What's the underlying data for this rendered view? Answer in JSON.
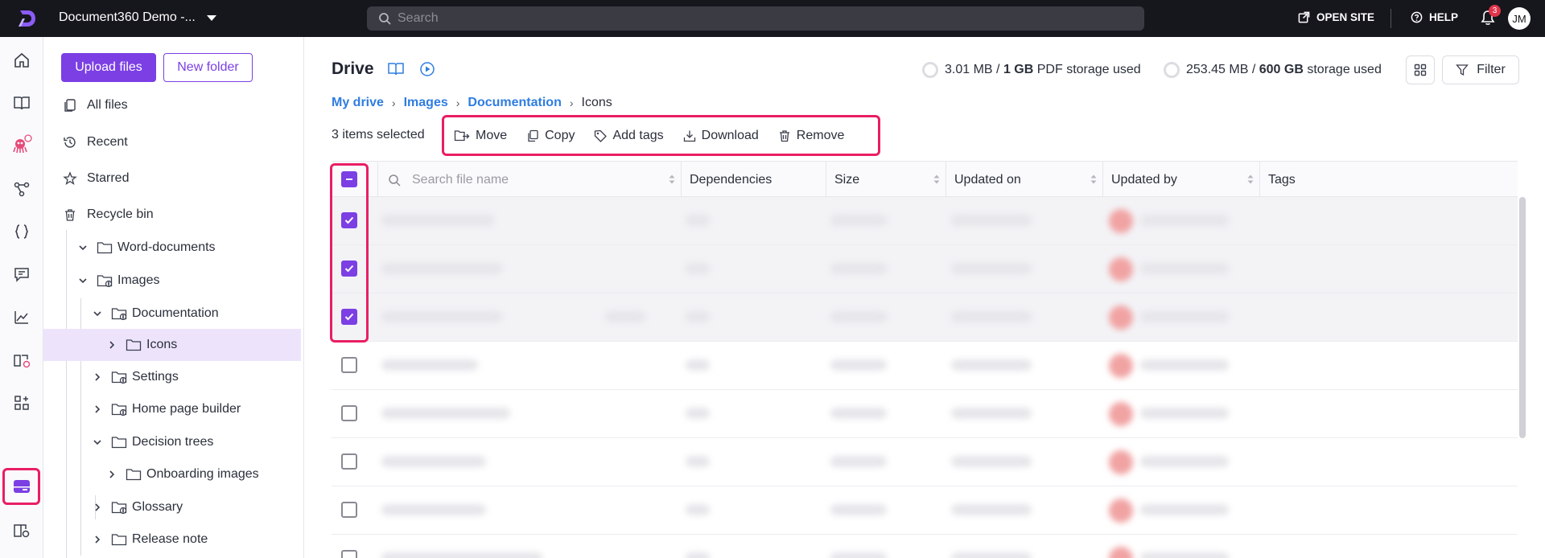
{
  "topbar": {
    "project_name": "Document360 Demo -...",
    "search_placeholder": "Search",
    "open_site_label": "OPEN SITE",
    "help_label": "HELP",
    "notification_count": "3",
    "avatar_initials": "JM"
  },
  "rail": {
    "icons": [
      "home-icon",
      "book-icon",
      "robot-icon",
      "workflow-icon",
      "code-braces-icon",
      "comment-icon",
      "analytics-icon",
      "book-star-icon",
      "apps-icon",
      "drive-icon",
      "book-settings-icon",
      "settings-icon"
    ],
    "active": "drive-icon"
  },
  "sidebar": {
    "upload_label": "Upload files",
    "new_folder_label": "New folder",
    "nav": [
      {
        "label": "All files",
        "icon": "files-icon"
      },
      {
        "label": "Recent",
        "icon": "history-icon"
      },
      {
        "label": "Starred",
        "icon": "star-icon"
      },
      {
        "label": "Recycle bin",
        "icon": "trash-icon"
      }
    ],
    "tree": [
      {
        "label": "Word-documents",
        "level": 0,
        "expanded": true,
        "shared": false
      },
      {
        "label": "Images",
        "level": 0,
        "expanded": true,
        "shared": true
      },
      {
        "label": "Documentation",
        "level": 1,
        "expanded": true,
        "shared": true
      },
      {
        "label": "Icons",
        "level": 2,
        "expanded": false,
        "shared": false,
        "selected": true
      },
      {
        "label": "Settings",
        "level": 1,
        "expanded": false,
        "shared": true
      },
      {
        "label": "Home page builder",
        "level": 1,
        "expanded": false,
        "shared": true
      },
      {
        "label": "Decision trees",
        "level": 1,
        "expanded": true,
        "shared": false
      },
      {
        "label": "Onboarding images",
        "level": 2,
        "expanded": false,
        "shared": false
      },
      {
        "label": "Glossary",
        "level": 1,
        "expanded": false,
        "shared": true
      },
      {
        "label": "Release note",
        "level": 1,
        "expanded": false,
        "shared": false
      }
    ]
  },
  "main": {
    "title": "Drive",
    "pdf_storage": {
      "used": "3.01 MB",
      "sep": "/",
      "total": "1 GB",
      "suffix": "PDF storage used"
    },
    "storage": {
      "used": "253.45 MB",
      "sep": "/",
      "total": "600 GB",
      "suffix": "storage used"
    },
    "filter_label": "Filter",
    "breadcrumb": [
      {
        "label": "My drive",
        "link": true
      },
      {
        "label": "Images",
        "link": true
      },
      {
        "label": "Documentation",
        "link": true
      },
      {
        "label": "Icons",
        "link": false
      }
    ],
    "selected_count": "3 items selected",
    "actions": [
      {
        "label": "Move",
        "icon": "move-icon"
      },
      {
        "label": "Copy",
        "icon": "copy-icon"
      },
      {
        "label": "Add tags",
        "icon": "tag-icon"
      },
      {
        "label": "Download",
        "icon": "download-icon"
      },
      {
        "label": "Remove",
        "icon": "trash-icon"
      }
    ],
    "table": {
      "search_placeholder": "Search file name",
      "columns": [
        "Dependencies",
        "Size",
        "Updated on",
        "Updated by",
        "Tags"
      ],
      "rows": [
        {
          "checked": true
        },
        {
          "checked": true
        },
        {
          "checked": true
        },
        {
          "checked": false
        },
        {
          "checked": false
        },
        {
          "checked": false
        },
        {
          "checked": false
        },
        {
          "checked": false
        }
      ]
    }
  },
  "colors": {
    "accent": "#7b3fe4",
    "highlight": "#e91e63",
    "topbar": "#16161d",
    "link": "#2f7de1"
  }
}
